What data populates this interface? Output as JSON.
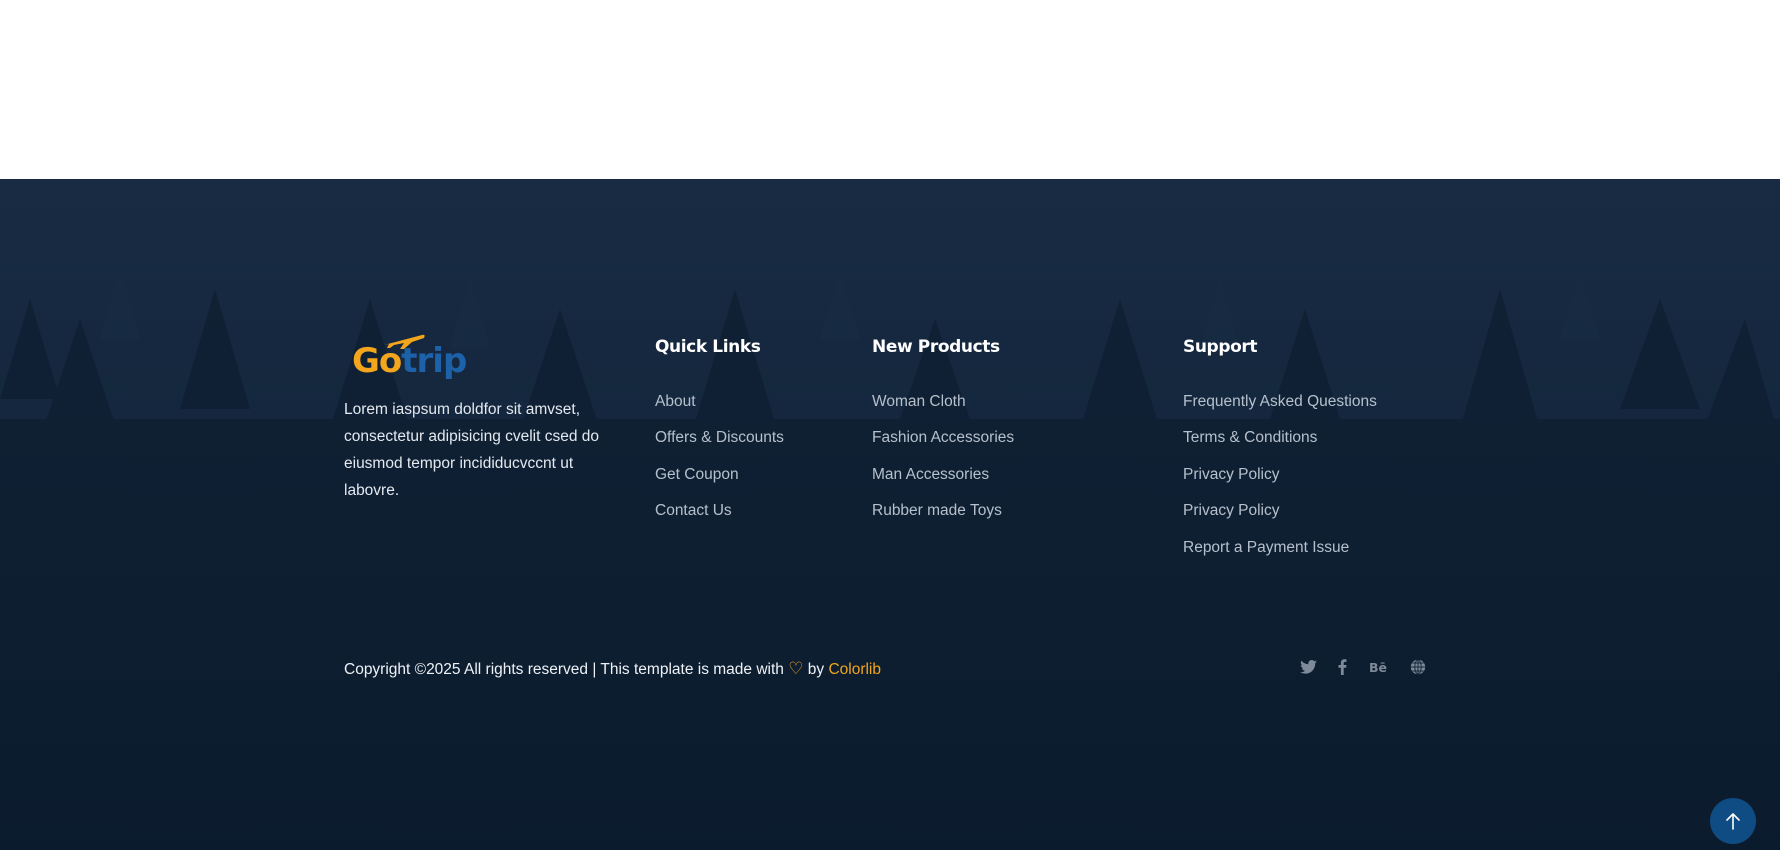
{
  "logo": {
    "part1": "Go",
    "part2": "trip"
  },
  "about": {
    "text": "Lorem iaspsum doldfor sit amvset, consectetur adipisicing cvelit csed do eiusmod tempor incididucvccnt ut labovre."
  },
  "columns": [
    {
      "title": "Quick Links",
      "links": [
        "About",
        "Offers & Discounts",
        "Get Coupon",
        "Contact Us"
      ]
    },
    {
      "title": "New Products",
      "links": [
        "Woman Cloth",
        "Fashion Accessories",
        "Man Accessories",
        "Rubber made Toys"
      ]
    },
    {
      "title": "Support",
      "links": [
        "Frequently Asked Questions",
        "Terms & Conditions",
        "Privacy Policy",
        "Privacy Policy",
        "Report a Payment Issue"
      ]
    }
  ],
  "copyright": {
    "prefix": "Copyright ©2025 All rights reserved | This template is made with ",
    "heart": "♡",
    "by": " by ",
    "link": "Colorlib"
  },
  "social": [
    "twitter-icon",
    "facebook-icon",
    "behance-icon",
    "globe-icon"
  ],
  "back_to_top": {
    "icon": "arrow-up-icon"
  },
  "colors": {
    "footer_bg": "#13263c",
    "accent": "#f2a51d",
    "logo_blue": "#1d62a8",
    "back_to_top_bg": "#0f4c84"
  }
}
